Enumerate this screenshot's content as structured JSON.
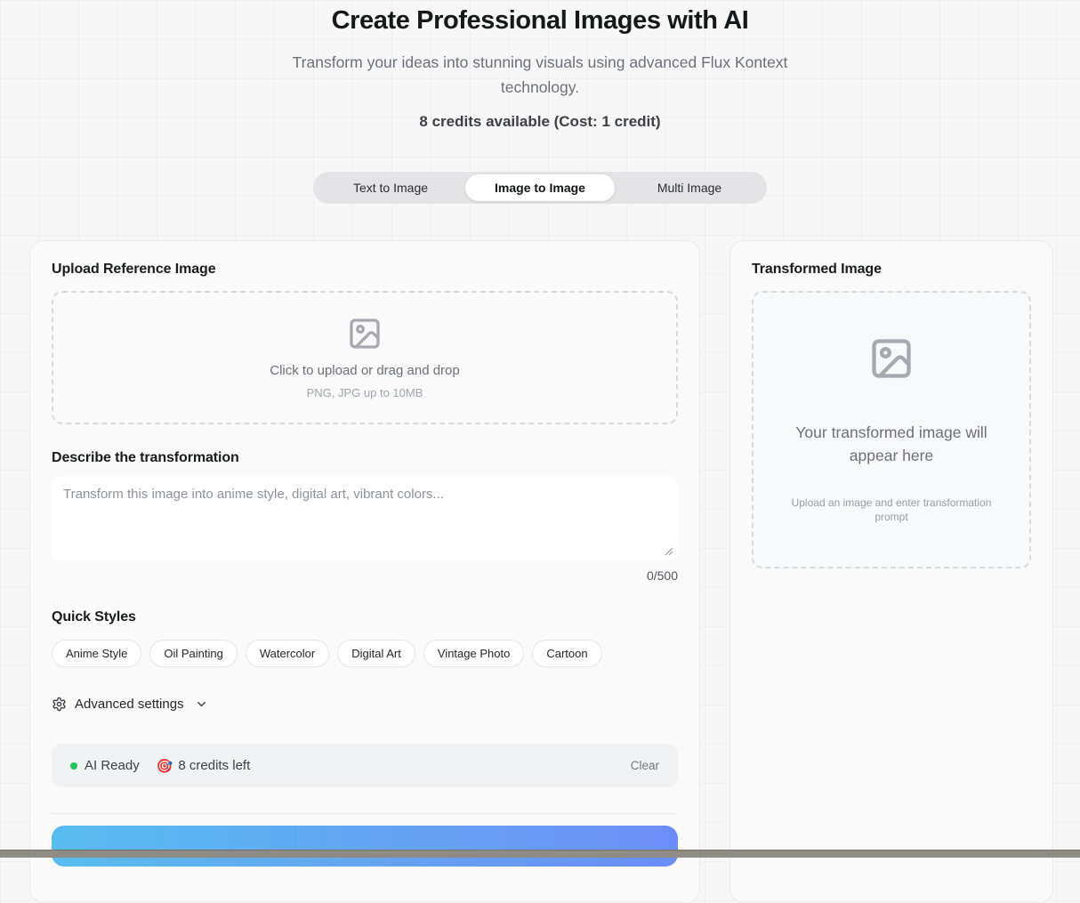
{
  "page": {
    "title": "Create Professional Images with AI",
    "subtitle": "Transform your ideas into stunning visuals using advanced Flux Kontext technology.",
    "credits_line": "8 credits available (Cost: 1 credit)"
  },
  "tabs": {
    "items": [
      {
        "label": "Text to Image",
        "active": false
      },
      {
        "label": "Image to Image",
        "active": true
      },
      {
        "label": "Multi Image",
        "active": false
      }
    ]
  },
  "upload_panel": {
    "title": "Upload Reference Image",
    "dropzone": {
      "icon": "image-icon",
      "primary_text": "Click to upload or drag and drop",
      "secondary_text": "PNG, JPG up to 10MB"
    },
    "prompt": {
      "label": "Describe the transformation",
      "value": "",
      "placeholder": "Transform this image into anime style, digital art, vibrant colors...",
      "char_count": "0/500"
    },
    "quick_styles": {
      "label": "Quick Styles",
      "options": [
        "Anime Style",
        "Oil Painting",
        "Watercolor",
        "Digital Art",
        "Vintage Photo",
        "Cartoon"
      ]
    },
    "advanced_settings": {
      "label": "Advanced settings",
      "icon": "gear-icon",
      "chevron": "chevron-down-icon"
    },
    "status_bar": {
      "ai_status": "AI Ready",
      "credits_icon": "🎯",
      "credits_left": "8 credits left",
      "clear_label": "Clear"
    }
  },
  "result_panel": {
    "title": "Transformed Image",
    "empty_state": {
      "icon": "image-icon",
      "primary_text": "Your transformed image will appear here",
      "secondary_text": "Upload an image and enter transformation prompt"
    }
  },
  "colors": {
    "status_green": "#22c55e",
    "accent_gradient_start": "#58bdee",
    "accent_gradient_end": "#6c8df8"
  }
}
